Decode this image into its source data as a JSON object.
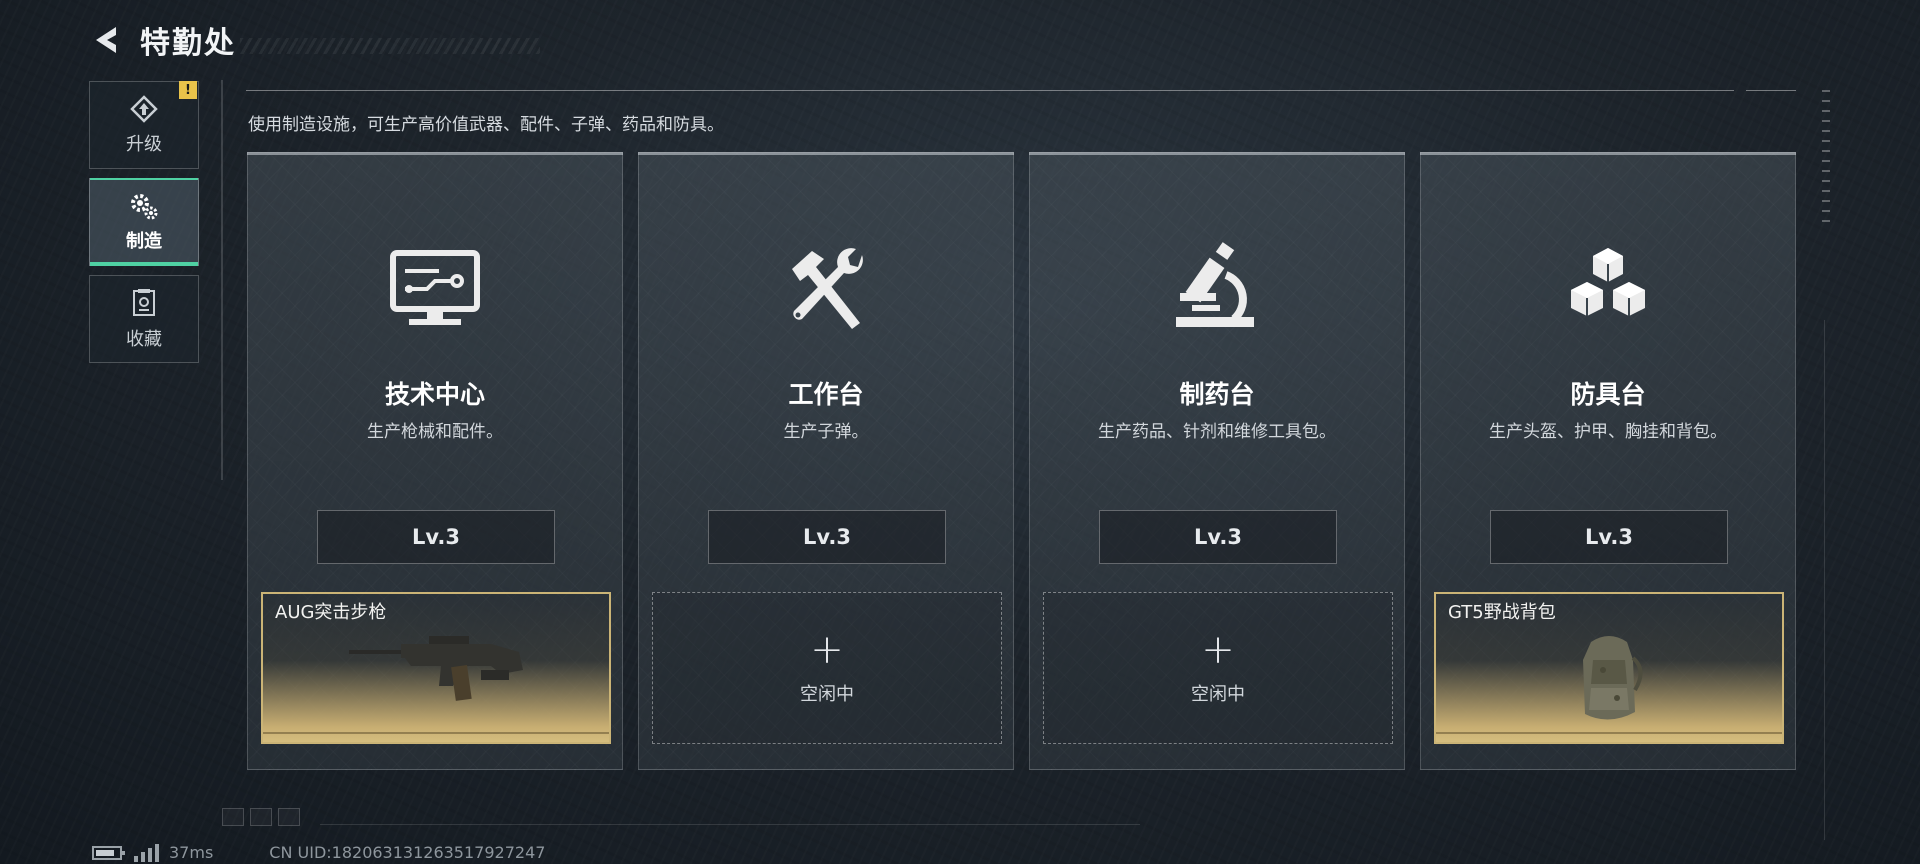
{
  "header": {
    "title": "特勤处"
  },
  "sidebar": {
    "items": [
      {
        "label": "升级",
        "icon": "upgrade-icon",
        "active": false,
        "badge": "!"
      },
      {
        "label": "制造",
        "icon": "gears-icon",
        "active": true
      },
      {
        "label": "收藏",
        "icon": "collection-icon",
        "active": false
      }
    ]
  },
  "description": "使用制造设施，可生产高价值武器、配件、子弹、药品和防具。",
  "cards": [
    {
      "title": "技术中心",
      "subtitle": "生产枪械和配件。",
      "level": "Lv.3",
      "icon": "monitor-circuit-icon",
      "slot": {
        "status": "busy",
        "item_name": "AUG突击步枪",
        "item_icon": "rifle-icon"
      }
    },
    {
      "title": "工作台",
      "subtitle": "生产子弹。",
      "level": "Lv.3",
      "icon": "hammer-wrench-icon",
      "slot": {
        "status": "idle",
        "label": "空闲中"
      }
    },
    {
      "title": "制药台",
      "subtitle": "生产药品、针剂和维修工具包。",
      "level": "Lv.3",
      "icon": "microscope-icon",
      "slot": {
        "status": "idle",
        "label": "空闲中"
      }
    },
    {
      "title": "防具台",
      "subtitle": "生产头盔、护甲、胸挂和背包。",
      "level": "Lv.3",
      "icon": "cubes-icon",
      "slot": {
        "status": "busy",
        "item_name": "GT5野战背包",
        "item_icon": "backpack-icon"
      }
    }
  ],
  "status_bar": {
    "ping": "37ms",
    "uid": "CN UID:1820631312635179272​47"
  },
  "colors": {
    "accent": "#4fd1a3",
    "gold": "#cbb476",
    "badge": "#e8c24a"
  }
}
